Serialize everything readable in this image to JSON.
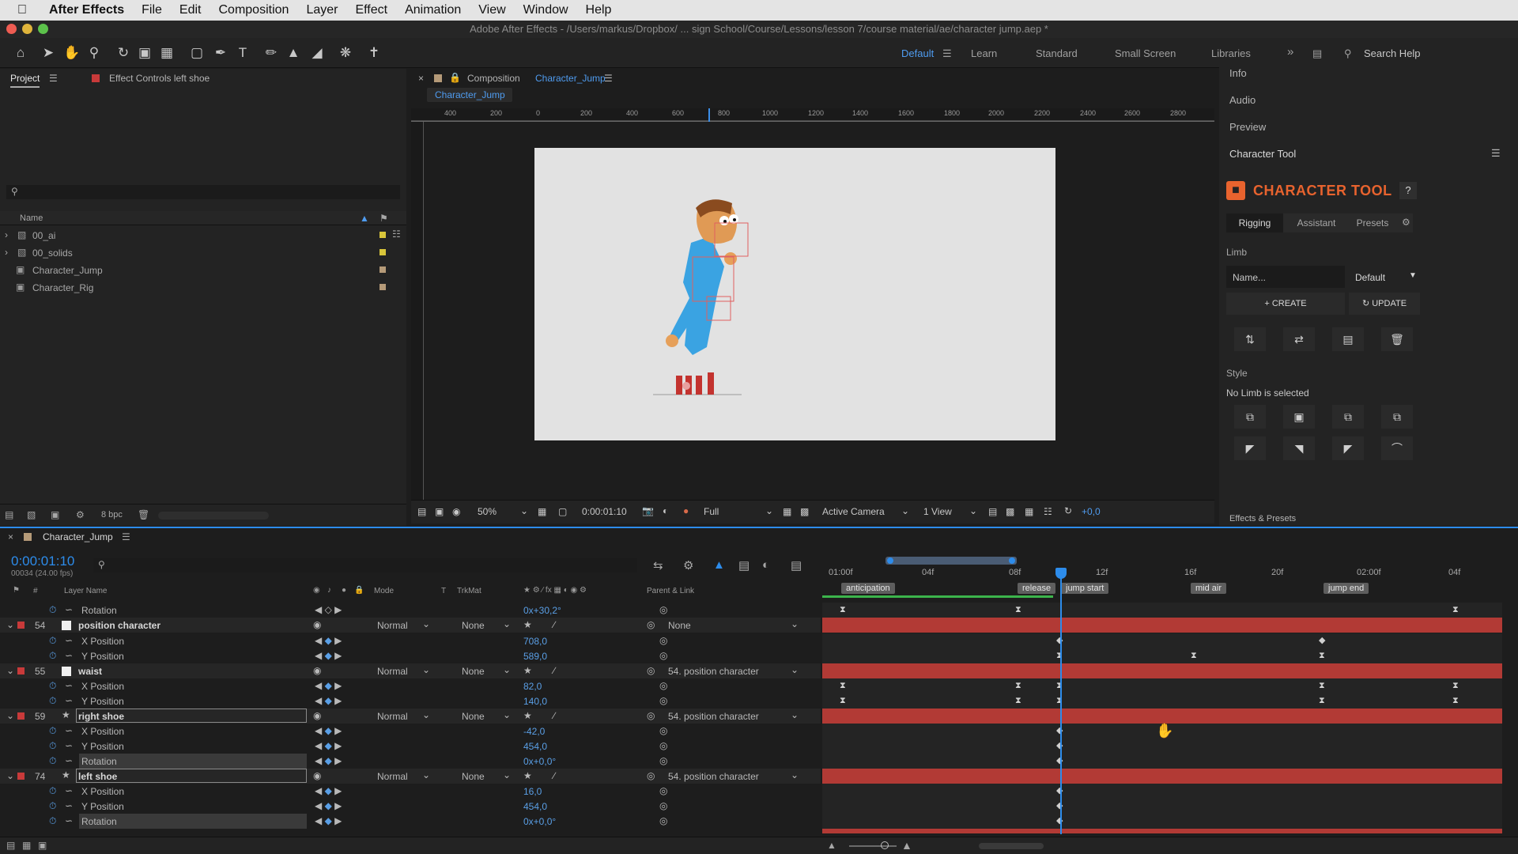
{
  "menubar": {
    "app": "After Effects",
    "items": [
      "File",
      "Edit",
      "Composition",
      "Layer",
      "Effect",
      "Animation",
      "View",
      "Window",
      "Help"
    ]
  },
  "title": "Adobe After Effects - /Users/markus/Dropbox/ ... sign School/Course/Lessons/lesson 7/course material/ae/character jump.aep *",
  "workspaces": {
    "default": "Default",
    "items": [
      "Learn",
      "Standard",
      "Small Screen",
      "Libraries"
    ],
    "search": "Search Help"
  },
  "project": {
    "tab": "Project",
    "effect_controls": "Effect Controls left shoe",
    "col_name": "Name",
    "items": [
      "00_ai",
      "00_solids",
      "Character_Jump",
      "Character_Rig"
    ],
    "bpc": "8 bpc"
  },
  "composition": {
    "tab_prefix": "Composition",
    "tab_name": "Character_Jump",
    "sub_tab": "Character_Jump",
    "ruler_ticks": [
      "400",
      "200",
      "0",
      "200",
      "400",
      "600",
      "800",
      "1000",
      "1200",
      "1400",
      "1600",
      "1800",
      "2000",
      "2200",
      "2400",
      "2600",
      "2800"
    ],
    "zoom": "50%",
    "timecode": "0:00:01:10",
    "resolution": "Full",
    "camera": "Active Camera",
    "view": "1 View",
    "exposure": "+0,0"
  },
  "right_panel": {
    "info": "Info",
    "audio": "Audio",
    "preview": "Preview",
    "character_tool": "Character Tool",
    "logo_text": "CHARACTER TOOL",
    "help": "?",
    "tabs": [
      "Rigging",
      "Assistant",
      "Presets"
    ],
    "limb_label": "Limb",
    "limb_name_placeholder": "Name...",
    "limb_default": "Default",
    "create": "CREATE",
    "update": "UPDATE",
    "style_label": "Style",
    "style_status": "No Limb is selected",
    "effects_presets": "Effects & Presets"
  },
  "timeline": {
    "tab": "Character_Jump",
    "timecode": "0:00:01:10",
    "frame_info": "00034 (24.00 fps)",
    "headers": {
      "layer_name": "Layer Name",
      "mode": "Mode",
      "t": "T",
      "trkmat": "TrkMat",
      "parent": "Parent & Link"
    },
    "ruler": [
      "01:00f",
      "04f",
      "08f",
      "12f",
      "16f",
      "20f",
      "02:00f",
      "04f"
    ],
    "markers": [
      "anticipation",
      "release",
      "jump start",
      "mid air",
      "jump end"
    ],
    "rows": [
      {
        "kind": "prop",
        "name": "Rotation",
        "value": "0x+30,2°"
      },
      {
        "kind": "layer",
        "num": "54",
        "name": "position character",
        "mode": "Normal",
        "trkmat": "None",
        "parent": "None"
      },
      {
        "kind": "prop",
        "name": "X Position",
        "value": "708,0"
      },
      {
        "kind": "prop",
        "name": "Y Position",
        "value": "589,0"
      },
      {
        "kind": "layer",
        "num": "55",
        "name": "waist",
        "mode": "Normal",
        "trkmat": "None",
        "parent": "54. position character"
      },
      {
        "kind": "prop",
        "name": "X Position",
        "value": "82,0"
      },
      {
        "kind": "prop",
        "name": "Y Position",
        "value": "140,0"
      },
      {
        "kind": "layer",
        "num": "59",
        "name": "right shoe",
        "mode": "Normal",
        "trkmat": "None",
        "parent": "54. position character"
      },
      {
        "kind": "prop",
        "name": "X Position",
        "value": "-42,0"
      },
      {
        "kind": "prop",
        "name": "Y Position",
        "value": "454,0"
      },
      {
        "kind": "prop",
        "name": "Rotation",
        "value": "0x+0,0°"
      },
      {
        "kind": "layer",
        "num": "74",
        "name": "left shoe",
        "mode": "Normal",
        "trkmat": "None",
        "parent": "54. position character"
      },
      {
        "kind": "prop",
        "name": "X Position",
        "value": "16,0"
      },
      {
        "kind": "prop",
        "name": "Y Position",
        "value": "454,0"
      },
      {
        "kind": "prop",
        "name": "Rotation",
        "value": "0x+0,0°"
      }
    ]
  },
  "colors": {
    "accent": "#2d8ceb",
    "layer_red": "#b23a35",
    "logo_orange": "#e8632e"
  }
}
